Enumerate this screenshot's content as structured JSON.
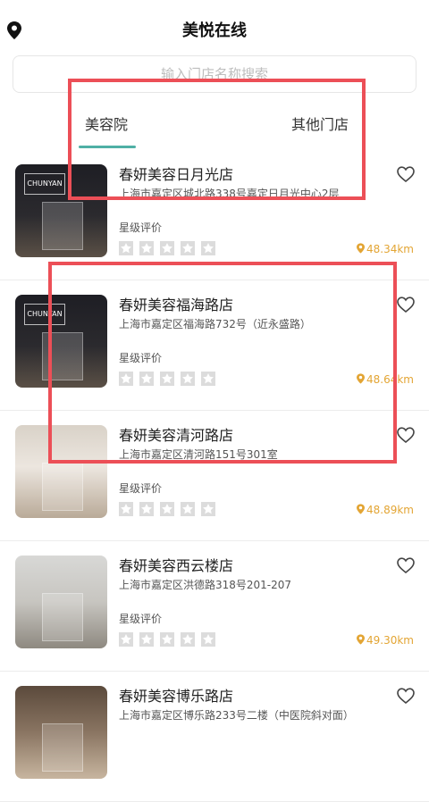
{
  "header": {
    "title": "美悦在线",
    "location_icon": "location-pin-icon"
  },
  "search": {
    "placeholder": "输入门店名称搜索"
  },
  "tabs": [
    {
      "label": "美容院",
      "active": true
    },
    {
      "label": "其他门店",
      "active": false
    }
  ],
  "colors": {
    "accent": "#4fb0a5",
    "distance": "#e3a534",
    "annotation": "#ec4f57",
    "star_bg": "#dcdcdc"
  },
  "stores": [
    {
      "name": "春妍美容日月光店",
      "address": "上海市嘉定区城北路338号嘉定日月光中心2层",
      "rating_label": "星级评价",
      "rating": 0,
      "distance": "48.34km",
      "logo": "CHUNYAN"
    },
    {
      "name": "春妍美容福海路店",
      "address": "上海市嘉定区福海路732号（近永盛路）",
      "rating_label": "星级评价",
      "rating": 0,
      "distance": "48.64km",
      "logo": "CHUNYAN"
    },
    {
      "name": "春妍美容清河路店",
      "address": "上海市嘉定区清河路151号301室",
      "rating_label": "星级评价",
      "rating": 0,
      "distance": "48.89km",
      "logo": ""
    },
    {
      "name": "春妍美容西云楼店",
      "address": "上海市嘉定区洪德路318号201-207",
      "rating_label": "星级评价",
      "rating": 0,
      "distance": "49.30km",
      "logo": ""
    },
    {
      "name": "春妍美容博乐路店",
      "address": "上海市嘉定区博乐路233号二楼（中医院斜对面）",
      "rating_label": "星级评价",
      "rating": 0,
      "distance": "",
      "logo": ""
    }
  ]
}
